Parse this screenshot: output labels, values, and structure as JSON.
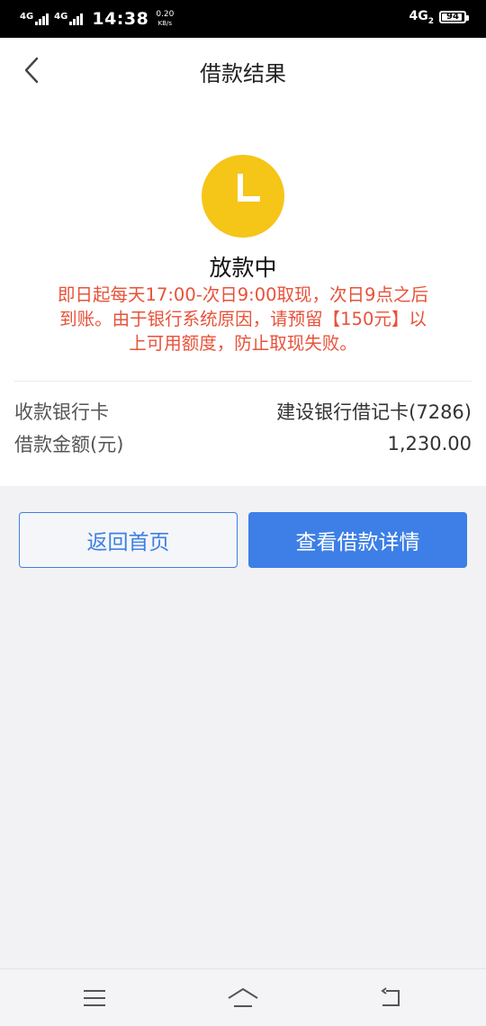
{
  "status_bar": {
    "network_1": "4G",
    "network_2": "4G",
    "time": "14:38",
    "speed_value": "0.20",
    "speed_unit": "KB/s",
    "network_right": "4G",
    "network_right_sub": "2",
    "battery_level": "94",
    "battery_fraction": 0.94
  },
  "header": {
    "back_icon": "chevron-left-icon",
    "title": "借款结果"
  },
  "result": {
    "status_icon": "clock-icon",
    "status_icon_color": "#f5c518",
    "status_text": "放款中",
    "notice_line_1": "即日起每天17:00-次日9:00取现，次日9点之后",
    "notice_line_2": "到账。由于银行系统原因，请预留【150元】以",
    "notice_line_3": "上可用额度，防止取现失败。",
    "notice_color": "#e8523a"
  },
  "details": [
    {
      "label": "收款银行卡",
      "value": "建设银行借记卡(7286)"
    },
    {
      "label": "借款金额(元)",
      "value": "1,230.00"
    }
  ],
  "actions": {
    "home_label": "返回首页",
    "detail_label": "查看借款详情",
    "accent_color": "#3d7fe6"
  },
  "bottom_nav": {
    "menu_icon": "menu-icon",
    "home_icon": "home-icon",
    "back_icon": "back-icon"
  }
}
